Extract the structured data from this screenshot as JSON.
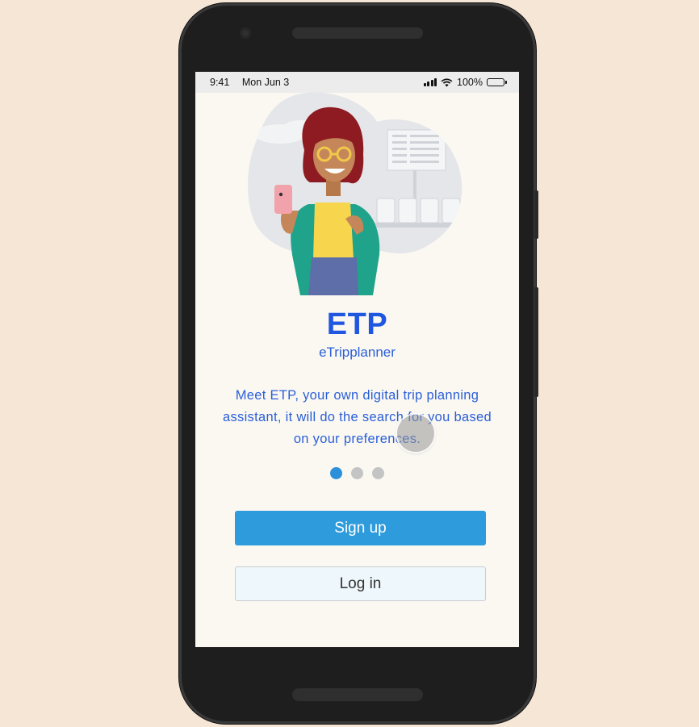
{
  "status_bar": {
    "time": "9:41",
    "date": "Mon Jun 3",
    "battery_percent": "100%",
    "icons": [
      "signal-icon",
      "wifi-icon",
      "battery-icon"
    ]
  },
  "onboarding": {
    "app_name": "ETP",
    "app_full_name": "eTripplanner",
    "description": "Meet ETP, your own digital trip planning assistant, it will do the search for you based on your preferences.",
    "pagination": {
      "total": 3,
      "active_index": 0
    }
  },
  "actions": {
    "signup_label": "Sign up",
    "login_label": "Log in"
  },
  "colors": {
    "primary": "#2e9bdc",
    "title": "#1f57e0",
    "background": "#fbf8f2",
    "frame_background": "#f5e6d6"
  }
}
